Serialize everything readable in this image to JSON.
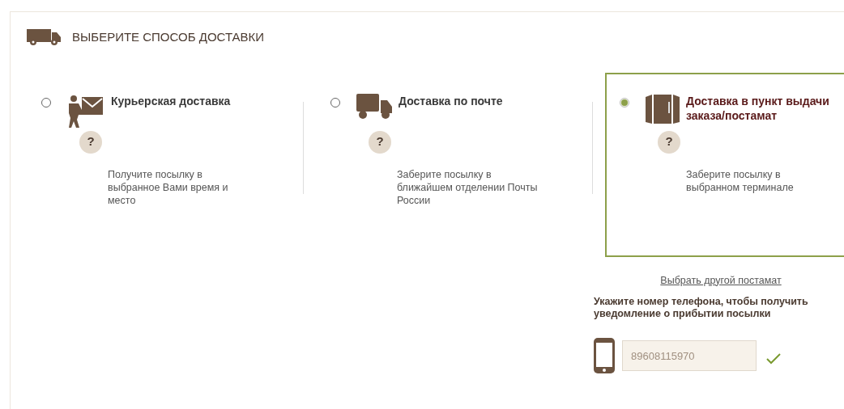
{
  "header": {
    "title": "ВЫБЕРИТЕ СПОСОБ ДОСТАВКИ"
  },
  "options": [
    {
      "kind": "courier",
      "title": "Курьерская доставка",
      "help": "?",
      "description": "Получите посылку в выбранное Вами время и место",
      "selected": false
    },
    {
      "kind": "truck",
      "title": "Доставка по почте",
      "help": "?",
      "description": "Заберите посылку в ближайшем отделении Почты России",
      "selected": false
    },
    {
      "kind": "locker",
      "title": "Доставка в пункт выдачи заказа/постамат",
      "help": "?",
      "description": "Заберите посылку в выбранном терминале",
      "selected": true
    }
  ],
  "change_link": "Выбрать другой постамат",
  "phone": {
    "prompt": "Укажите номер телефона, чтобы получить уведомление о прибытии посылки",
    "value": "89608115970",
    "valid": true
  }
}
